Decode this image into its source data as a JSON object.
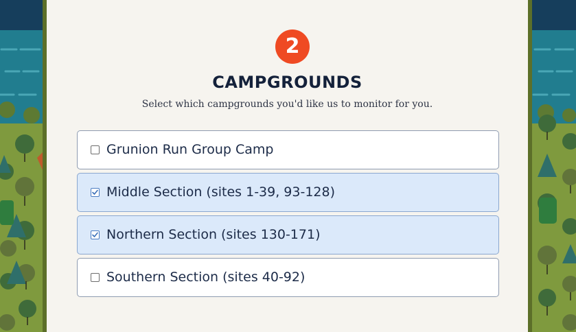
{
  "step": {
    "number": "2"
  },
  "heading": "CAMPGROUNDS",
  "subheading": "Select which campgrounds you'd like us to monitor for you.",
  "campgrounds": [
    {
      "label": "Grunion Run Group Camp",
      "checked": false
    },
    {
      "label": "Middle Section (sites 1-39, 93-128)",
      "checked": true
    },
    {
      "label": "Northern Section (sites 130-171)",
      "checked": true
    },
    {
      "label": "Southern Section (sites 40-92)",
      "checked": false
    }
  ],
  "colors": {
    "accent": "#ef4a23",
    "heading": "#14213a",
    "selected_bg": "#dbe9fa",
    "panel_bg": "#f6f4ef",
    "water": "#217d8f",
    "forest": "#7f9a3e"
  },
  "icons": {
    "checkbox": "checkbox-icon",
    "checkmark": "checkmark-icon"
  }
}
